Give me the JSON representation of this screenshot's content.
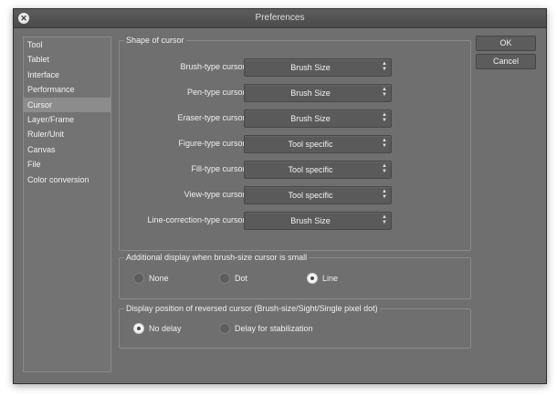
{
  "window": {
    "title": "Preferences",
    "close_glyph": "✕"
  },
  "sidebar": {
    "items": [
      {
        "label": "Tool"
      },
      {
        "label": "Tablet"
      },
      {
        "label": "Interface"
      },
      {
        "label": "Performance"
      },
      {
        "label": "Cursor",
        "selected": true
      },
      {
        "label": "Layer/Frame"
      },
      {
        "label": "Ruler/Unit"
      },
      {
        "label": "Canvas"
      },
      {
        "label": "File"
      },
      {
        "label": "Color conversion"
      }
    ]
  },
  "shape_group": {
    "legend": "Shape of cursor",
    "rows": [
      {
        "label": "Brush-type cursor:",
        "value": "Brush Size"
      },
      {
        "label": "Pen-type cursor:",
        "value": "Brush Size"
      },
      {
        "label": "Eraser-type cursor:",
        "value": "Brush Size"
      },
      {
        "label": "Figure-type cursor:",
        "value": "Tool specific"
      },
      {
        "label": "Fill-type cursor:",
        "value": "Tool specific"
      },
      {
        "label": "View-type cursor:",
        "value": "Tool specific"
      },
      {
        "label": "Line-correction-type cursor:",
        "value": "Brush Size"
      }
    ]
  },
  "additional_group": {
    "legend": "Additional display when brush-size cursor is small",
    "options": [
      {
        "label": "None",
        "checked": false
      },
      {
        "label": "Dot",
        "checked": false
      },
      {
        "label": "Line",
        "checked": true
      }
    ]
  },
  "reversed_group": {
    "legend": "Display position of reversed cursor (Brush-size/Sight/Single pixel dot)",
    "options": [
      {
        "label": "No delay",
        "checked": true
      },
      {
        "label": "Delay for stabilization",
        "checked": false
      }
    ]
  },
  "buttons": {
    "ok": "OK",
    "cancel": "Cancel"
  },
  "icons": {
    "close": "close-icon",
    "select_arrows": "updown-arrows-icon"
  }
}
